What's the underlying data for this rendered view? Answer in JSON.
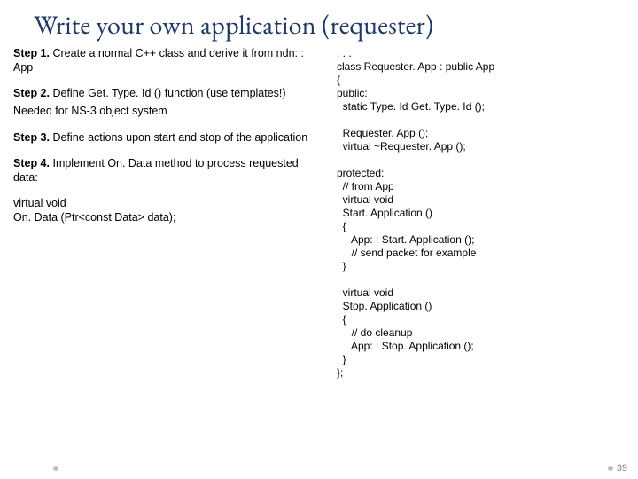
{
  "title": "Write your own application (requester)",
  "steps": {
    "s1": {
      "label": "Step 1.",
      "body": " Create a normal C++ class and derive it from ndn: : App"
    },
    "s2": {
      "label": "Step 2.",
      "body": " Define Get. Type. Id () function (use templates!)",
      "extra": "Needed for NS-3 object system"
    },
    "s3": {
      "label": "Step 3.",
      "body": " Define actions upon start and stop of the application"
    },
    "s4": {
      "label": "Step 4.",
      "body_pre": " Implement ",
      "body_em": "On. Data",
      "body_post": " method to process requested data:"
    },
    "s4_code1": "virtual void",
    "s4_code2": "On. Data (Ptr<const Data> data);"
  },
  "code": ". . .\nclass Requester. App : public App\n{\npublic:\n  static Type. Id Get. Type. Id ();\n\n  Requester. App ();\n  virtual ~Requester. App ();\n\nprotected:\n  // from App\n  virtual void\n  Start. Application ()\n  {\n     App: : Start. Application ();\n     // send packet for example\n  }\n\n  virtual void\n  Stop. Application ()\n  {\n     // do cleanup\n     App: : Stop. Application ();\n  }\n};",
  "page_number": "39"
}
